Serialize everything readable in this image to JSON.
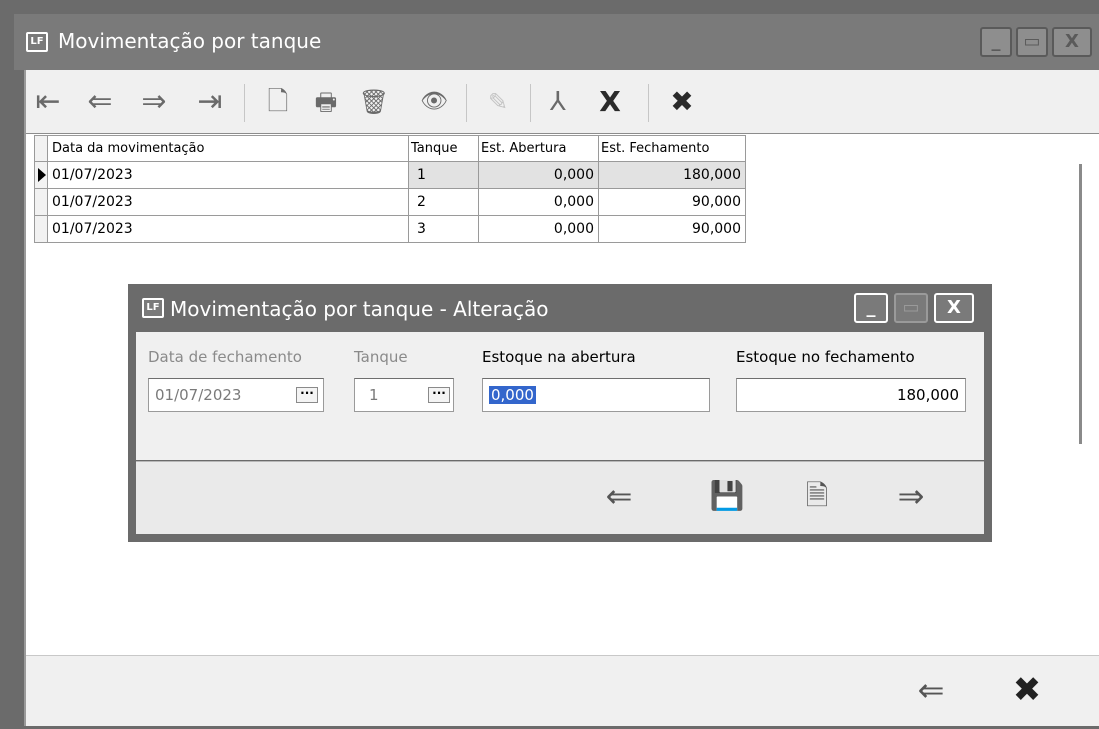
{
  "window": {
    "title": "Movimentação por tanque",
    "app_icon": "LF",
    "controls": [
      "_",
      "▭",
      "X"
    ]
  },
  "toolbar": {
    "first": "⇤",
    "prev": "⇐",
    "next": "⇒",
    "last": "⇥",
    "new": "🗋",
    "print": "🖶",
    "delete": "🗑",
    "view": "👁",
    "edit": "✎",
    "pdf": "⅄",
    "excel": "X",
    "close": "✖"
  },
  "grid": {
    "columns": [
      "Data da movimentação",
      "Tanque",
      "Est. Abertura",
      "Est. Fechamento"
    ],
    "rows": [
      {
        "date": "01/07/2023",
        "tank": "1",
        "open": "0,000",
        "close": "180,000",
        "current": true
      },
      {
        "date": "01/07/2023",
        "tank": "2",
        "open": "0,000",
        "close": "90,000",
        "current": false
      },
      {
        "date": "01/07/2023",
        "tank": "3",
        "open": "0,000",
        "close": "90,000",
        "current": false
      }
    ]
  },
  "dialog": {
    "title": "Movimentação por tanque - Alteração",
    "app_icon": "LF",
    "fields": {
      "close_date_label": "Data de fechamento",
      "close_date_value": "01/07/2023",
      "tank_label": "Tanque",
      "tank_value": "1",
      "open_stock_label": "Estoque na abertura",
      "open_stock_value": "0,000",
      "close_stock_label": "Estoque no fechamento",
      "close_stock_value": "180,000"
    },
    "lookup": "···",
    "buttons": {
      "prev": "⇐",
      "save": "💾",
      "cancel": "🗎",
      "next": "⇒"
    }
  },
  "footer": {
    "back": "⇐",
    "close": "✖"
  },
  "colors": {
    "title_bar": "#7a7a7a",
    "selection": "#3366cc"
  }
}
